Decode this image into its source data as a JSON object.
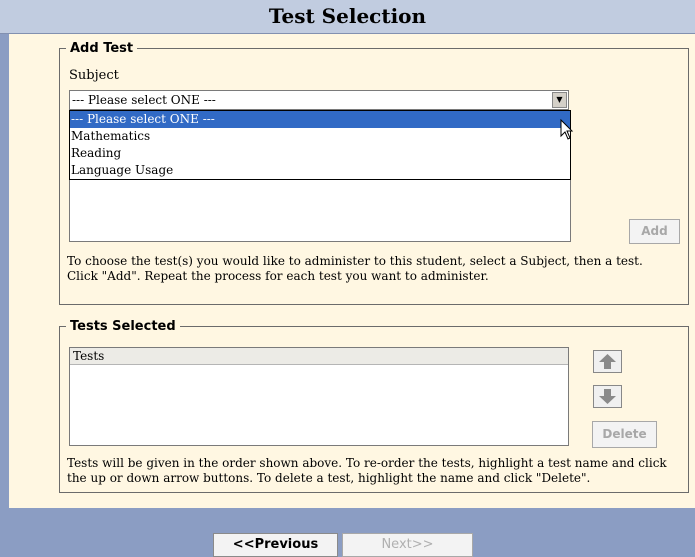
{
  "header": {
    "title": "Test Selection"
  },
  "add_test": {
    "legend": "Add Test",
    "subject_label": "Subject",
    "subject_value": "--- Please select ONE ---",
    "options": [
      "--- Please select ONE ---",
      "Mathematics",
      "Reading",
      "Language Usage"
    ],
    "add_label": "Add",
    "help": "To choose the test(s) you would like to administer to this student, select a Subject, then a test. Click \"Add\".  Repeat the process for each test you want to administer."
  },
  "tests_selected": {
    "legend": "Tests Selected",
    "column_header": "Tests",
    "delete_label": "Delete",
    "help": "Tests will be given in the order shown above.  To re-order the tests, highlight a test name and click the up or down arrow buttons.  To delete a test, highlight the name and click \"Delete\"."
  },
  "nav": {
    "previous_label": "<<Previous",
    "next_label": "Next>>"
  },
  "icons": {
    "dropdown": "dropdown-arrow-icon",
    "up": "up-arrow-icon",
    "down": "down-arrow-icon",
    "cursor": "mouse-cursor-icon"
  },
  "colors": {
    "header_bg": "#c1cce0",
    "panel_bg": "#fff7e2",
    "frame_bg": "#8b9dc3",
    "highlight": "#316ac5"
  }
}
